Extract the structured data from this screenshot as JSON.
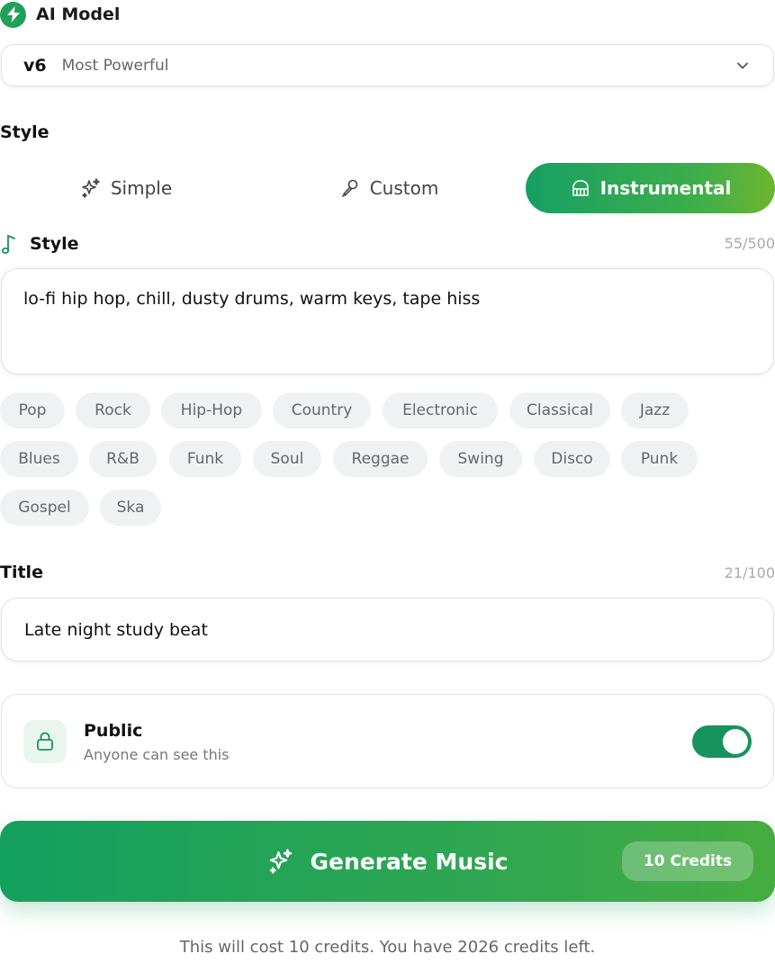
{
  "ai_model": {
    "title": "AI Model",
    "icon": "bolt-icon",
    "selected_version": "v6",
    "selected_description": "Most Powerful"
  },
  "style_section": {
    "label": "Style",
    "tabs": [
      {
        "label": "Simple",
        "icon": "sparkles-icon",
        "active": false
      },
      {
        "label": "Custom",
        "icon": "pen-icon",
        "active": false
      },
      {
        "label": "Instrumental",
        "icon": "piano-icon",
        "active": true
      }
    ]
  },
  "style_field": {
    "label": "Style",
    "icon": "music-note-icon",
    "count": "55/500",
    "value": "lo-fi hip hop, chill, dusty drums, warm keys, tape hiss"
  },
  "genres": [
    "Pop",
    "Rock",
    "Hip-Hop",
    "Country",
    "Electronic",
    "Classical",
    "Jazz",
    "Blues",
    "R&B",
    "Funk",
    "Soul",
    "Reggae",
    "Swing",
    "Disco",
    "Punk",
    "Gospel",
    "Ska"
  ],
  "title_field": {
    "label": "Title",
    "count": "21/100",
    "value": "Late night study beat"
  },
  "visibility": {
    "title": "Public",
    "subtitle": "Anyone can see this",
    "enabled": true
  },
  "generate": {
    "label": "Generate Music",
    "credits": "10 Credits"
  },
  "footnote": "This will cost 10 credits. You have 2026 credits left.",
  "colors": {
    "accent": "#17a064",
    "accent_end": "#6fb52e",
    "chip_bg": "#eff1f3"
  }
}
